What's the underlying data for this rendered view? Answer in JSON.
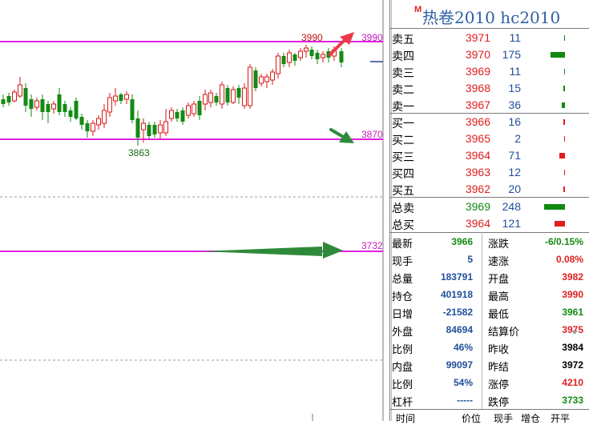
{
  "header": {
    "badge": "M",
    "title": "热卷2010  hc2010"
  },
  "colors": {
    "up": "#e01e1e",
    "down": "#138a13",
    "vol": "#1f4f9a",
    "magenta": "#e020e0",
    "bar_green": "#0f8a0f",
    "bar_red": "#e01e1e"
  },
  "chart": {
    "label_high": "3990",
    "label_low": "3863",
    "price_tag_upper": "3990",
    "price_tag_middle": "3870",
    "price_tag_lower": "3732"
  },
  "order_book": {
    "asks": [
      {
        "label": "卖五",
        "price": "3971",
        "volume": "11",
        "level": 0.04
      },
      {
        "label": "卖四",
        "price": "3970",
        "volume": "175",
        "level": 0.7
      },
      {
        "label": "卖三",
        "price": "3969",
        "volume": "11",
        "level": 0.04
      },
      {
        "label": "卖二",
        "price": "3968",
        "volume": "15",
        "level": 0.06
      },
      {
        "label": "卖一",
        "price": "3967",
        "volume": "36",
        "level": 0.14
      }
    ],
    "bids": [
      {
        "label": "买一",
        "price": "3966",
        "volume": "16",
        "level": 0.06
      },
      {
        "label": "买二",
        "price": "3965",
        "volume": "2",
        "level": 0.01
      },
      {
        "label": "买三",
        "price": "3964",
        "volume": "71",
        "level": 0.28
      },
      {
        "label": "买四",
        "price": "3963",
        "volume": "12",
        "level": 0.05
      },
      {
        "label": "买五",
        "price": "3962",
        "volume": "20",
        "level": 0.08
      }
    ]
  },
  "totals": [
    {
      "label": "总卖",
      "price": "3969",
      "volume": "248",
      "level": 1.0,
      "color": "down"
    },
    {
      "label": "总买",
      "price": "3964",
      "volume": "121",
      "level": 0.49,
      "color": "up"
    }
  ],
  "stats_left": [
    {
      "label": "最新",
      "value": "3966",
      "color": "down"
    },
    {
      "label": "现手",
      "value": "5",
      "color": "vol"
    },
    {
      "label": "总量",
      "value": "183791",
      "color": "vol"
    },
    {
      "label": "持仓",
      "value": "401918",
      "color": "vol"
    },
    {
      "label": "日增",
      "value": "-21582",
      "color": "vol"
    },
    {
      "label": "外盘",
      "value": "84694",
      "color": "vol"
    },
    {
      "label": "比例",
      "value": "46%",
      "color": "vol"
    },
    {
      "label": "内盘",
      "value": "99097",
      "color": "vol"
    },
    {
      "label": "比例",
      "value": "54%",
      "color": "vol"
    },
    {
      "label": "杠杆",
      "value": "-----",
      "color": "vol"
    }
  ],
  "stats_right": [
    {
      "label": "涨跌",
      "value": "-6/0.15%",
      "color": "down"
    },
    {
      "label": "速涨",
      "value": "0.08%",
      "color": "up"
    },
    {
      "label": "开盘",
      "value": "3982",
      "color": "up"
    },
    {
      "label": "最高",
      "value": "3990",
      "color": "up"
    },
    {
      "label": "最低",
      "value": "3961",
      "color": "down"
    },
    {
      "label": "结算价",
      "value": "3975",
      "color": "up"
    },
    {
      "label": "昨收",
      "value": "3984",
      "color": "black"
    },
    {
      "label": "昨结",
      "value": "3972",
      "color": "black"
    },
    {
      "label": "涨停",
      "value": "4210",
      "color": "up"
    },
    {
      "label": "跌停",
      "value": "3733",
      "color": "down"
    }
  ],
  "footer": {
    "time": "时间",
    "price": "价位",
    "hand": "现手",
    "oi_change": "增仓",
    "open_close": "开平"
  }
}
